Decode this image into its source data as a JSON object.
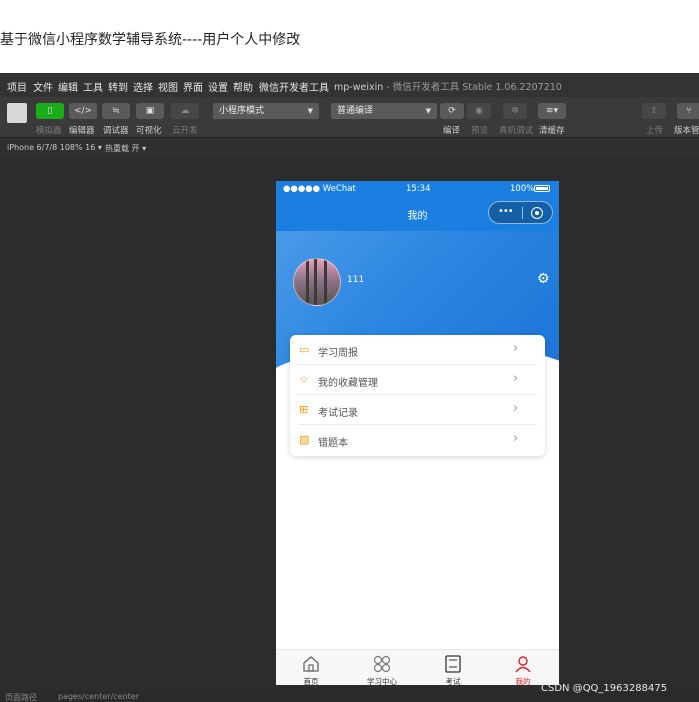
{
  "article": {
    "title": "基于微信小程序数学辅导系统----用户个人中修改"
  },
  "menu": {
    "items": [
      "项目",
      "文件",
      "编辑",
      "工具",
      "转到",
      "选择",
      "视图",
      "界面",
      "设置",
      "帮助",
      "微信开发者工具"
    ],
    "project_name": "mp-weixin",
    "app_info": "- 微信开发者工具 Stable 1.06.2207210"
  },
  "toolbar": {
    "simulator": "模拟器",
    "editor": "编辑器",
    "debugger": "调试器",
    "visual": "可视化",
    "cloud_dev": "云开发",
    "mode_select": "小程序模式",
    "compile_select": "普通编译",
    "compile": "编译",
    "preview": "预览",
    "remote_debug": "真机调试",
    "clear_cache": "清缓存",
    "upload": "上传",
    "version": "版本管"
  },
  "subbar": {
    "device": "iPhone 6/7/8 108% 16 ▾",
    "hot_reload": "热重载 开 ▾"
  },
  "statusbar": {
    "path_label": "页面路径",
    "path": "pages/center/center"
  },
  "phone": {
    "status": {
      "carrier": "●●●●● WeChat",
      "time": "15:34",
      "battery": "100%"
    },
    "nav_title": "我的",
    "user": {
      "name": "111"
    },
    "menu_items": [
      {
        "label": "学习周报",
        "icon": "calendar-icon"
      },
      {
        "label": "我的收藏管理",
        "icon": "star-icon"
      },
      {
        "label": "考试记录",
        "icon": "grid-icon"
      },
      {
        "label": "错题本",
        "icon": "image-icon"
      }
    ],
    "tabs": [
      {
        "label": "首页",
        "icon": "home-icon"
      },
      {
        "label": "学习中心",
        "icon": "clover-icon"
      },
      {
        "label": "考试",
        "icon": "exam-paper-icon"
      },
      {
        "label": "我的",
        "icon": "user-icon",
        "active": true
      }
    ],
    "colors": {
      "primary": "#1a7fe0",
      "accent": "#f0a020",
      "active_tab": "#e02020"
    }
  },
  "watermark": "CSDN @QQ_1963288475"
}
